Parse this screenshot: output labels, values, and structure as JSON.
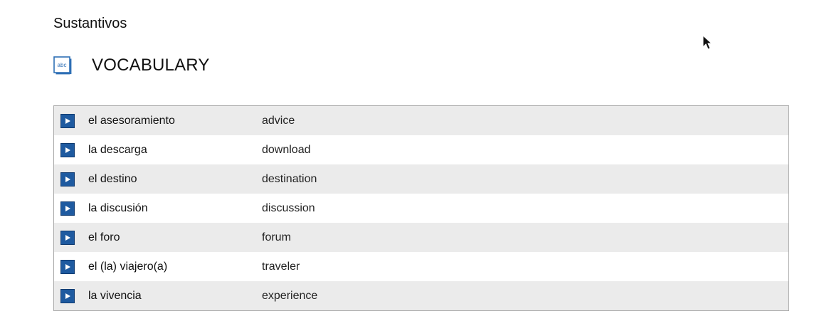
{
  "section": {
    "heading": "Sustantivos"
  },
  "vocabulary": {
    "title": "VOCABULARY",
    "icon": "abc-book-icon",
    "icon_text": "abc",
    "rows": [
      {
        "spanish": "el asesoramiento",
        "english": "advice"
      },
      {
        "spanish": "la descarga",
        "english": "download"
      },
      {
        "spanish": "el destino",
        "english": "destination"
      },
      {
        "spanish": "la discusión",
        "english": "discussion"
      },
      {
        "spanish": "el foro",
        "english": "forum"
      },
      {
        "spanish": "el (la) viajero(a)",
        "english": "traveler"
      },
      {
        "spanish": "la vivencia",
        "english": "experience"
      }
    ]
  },
  "colors": {
    "play_button": "#1e5aa0",
    "row_shade": "#ebebeb",
    "border": "#a8a8a8"
  }
}
